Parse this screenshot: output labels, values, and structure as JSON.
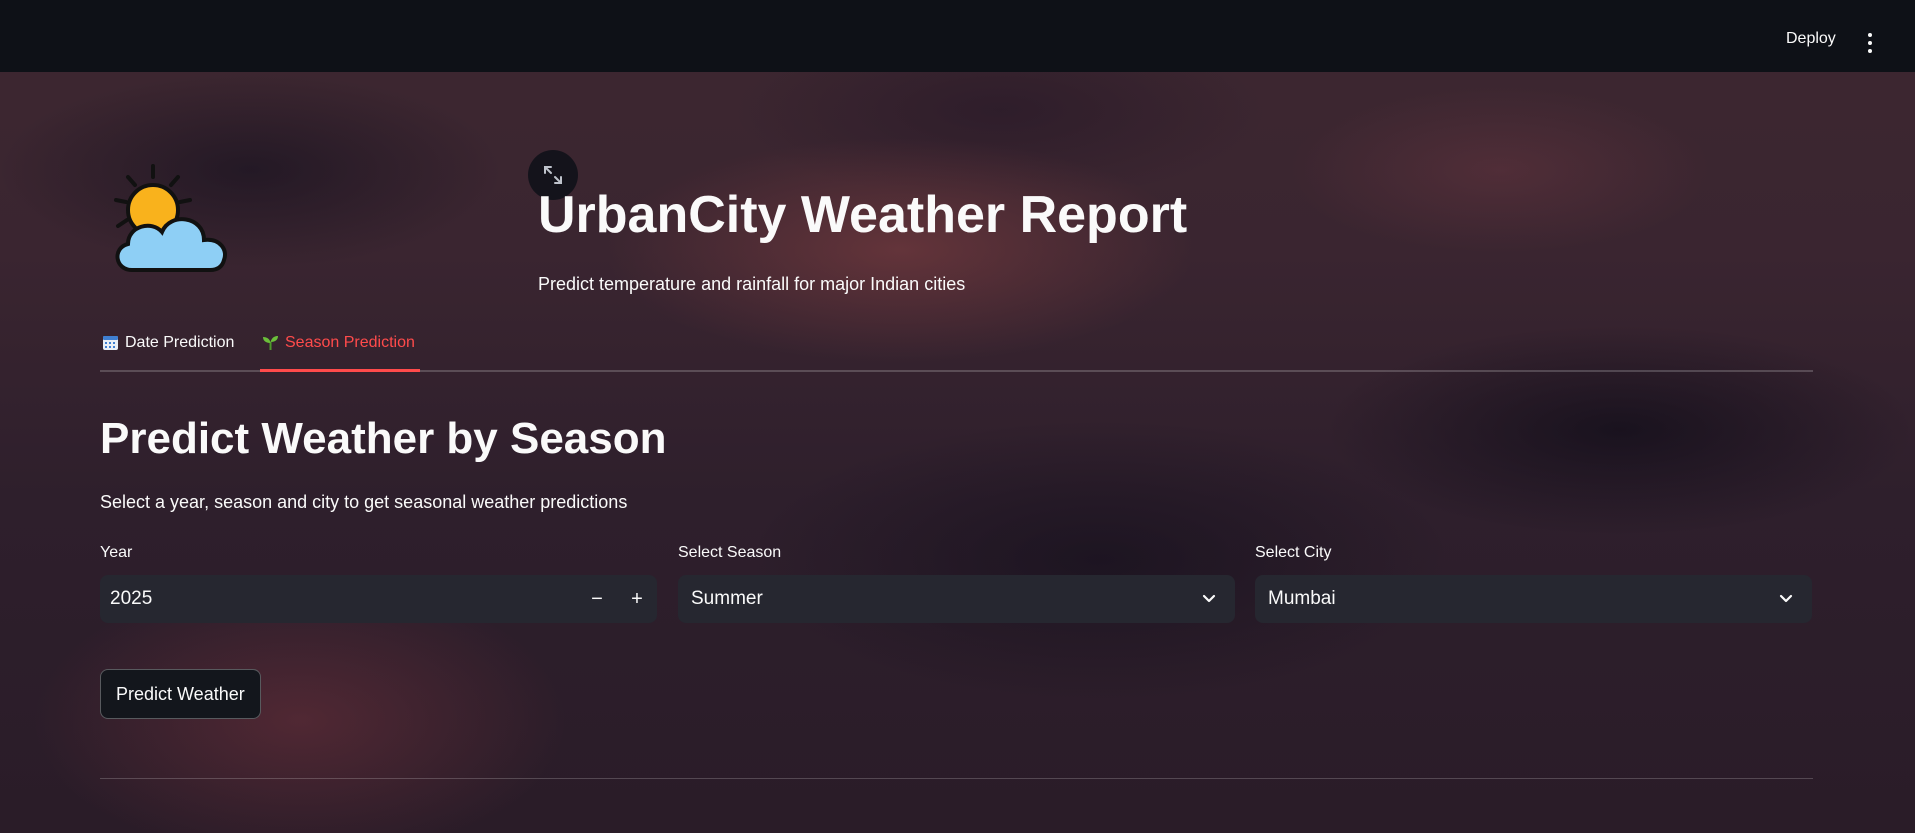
{
  "header": {
    "deploy_label": "Deploy",
    "menu_icon": "more-vertical-icon"
  },
  "app": {
    "title": "UrbanCity Weather Report",
    "subtitle": "Predict temperature and rainfall for major Indian cities",
    "logo_icon": "sun-behind-cloud-icon"
  },
  "tabs": [
    {
      "label": "Date Prediction",
      "icon": "calendar-icon",
      "active": false
    },
    {
      "label": "Season Prediction",
      "icon": "seedling-icon",
      "active": true
    }
  ],
  "season_form": {
    "heading": "Predict Weather by Season",
    "description": "Select a year, season and city to get seasonal weather predictions",
    "year": {
      "label": "Year",
      "value": "2025",
      "decrement": "−",
      "increment": "+"
    },
    "season": {
      "label": "Select Season",
      "value": "Summer"
    },
    "city": {
      "label": "Select City",
      "value": "Mumbai"
    },
    "submit_label": "Predict Weather"
  },
  "colors": {
    "header_bg": "#0e1117",
    "accent": "#ff4b4b",
    "input_bg": "#262730",
    "text": "#fafafa"
  }
}
